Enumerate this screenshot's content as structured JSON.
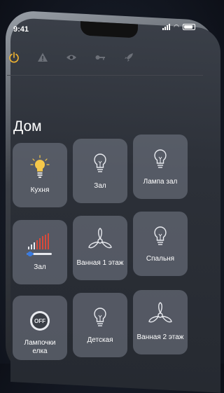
{
  "status": {
    "time": "9:41"
  },
  "toolbar": {
    "icons": [
      "power-icon",
      "warning-icon",
      "eye-icon",
      "key-icon",
      "rocket-icon"
    ],
    "active_color": "#f2b530"
  },
  "section": {
    "title": "Дом"
  },
  "tiles": [
    {
      "label": "Кухня",
      "icon": "bulb-on-icon",
      "state": "on"
    },
    {
      "label": "Зал",
      "icon": "bulb-icon",
      "state": "off"
    },
    {
      "label": "Лампа зал",
      "icon": "bulb-icon",
      "state": "off"
    },
    {
      "label": "Зал",
      "icon": "dimmer-icon",
      "state": "on"
    },
    {
      "label": "Ванная 1 этаж",
      "icon": "fan-icon",
      "state": "off"
    },
    {
      "label": "Спальня",
      "icon": "bulb-icon",
      "state": "off"
    },
    {
      "label": "Лампочки елка",
      "icon": "off-badge-icon",
      "state": "off"
    },
    {
      "label": "Детская",
      "icon": "bulb-icon",
      "state": "off"
    },
    {
      "label": "Ванная 2 этаж",
      "icon": "fan-icon",
      "state": "off"
    }
  ]
}
